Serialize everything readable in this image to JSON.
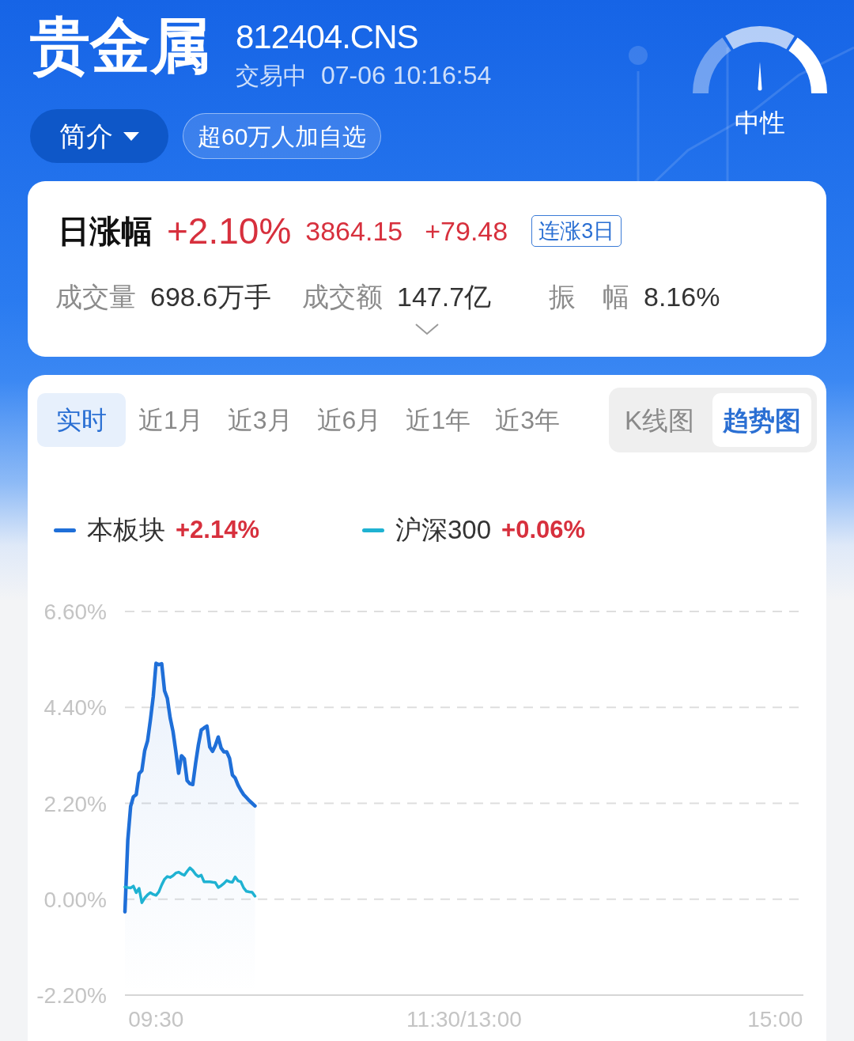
{
  "header": {
    "title": "贵金属",
    "code": "812404.CNS",
    "status": "交易中",
    "datetime": "07-06 10:16:54",
    "buttons": [
      {
        "label": "简介",
        "kind": "dropdown"
      },
      {
        "label": "超60万人加自选",
        "kind": "tag"
      }
    ],
    "sentiment": {
      "label": "中性",
      "level": 0.5
    }
  },
  "quote": {
    "label": "日涨幅",
    "change_pct": "+2.10%",
    "price": "3864.15",
    "change": "+79.48",
    "streak_badge": "连涨3日",
    "stats": [
      {
        "label": "成交量",
        "value": "698.6万手"
      },
      {
        "label": "成交额",
        "value": "147.7亿"
      },
      {
        "label": "振　幅",
        "value": "8.16%"
      }
    ],
    "expanded": false
  },
  "chart_panel": {
    "periods": [
      {
        "label": "实时",
        "selected": true
      },
      {
        "label": "近1月",
        "selected": false
      },
      {
        "label": "近3月",
        "selected": false
      },
      {
        "label": "近6月",
        "selected": false
      },
      {
        "label": "近1年",
        "selected": false
      },
      {
        "label": "近3年",
        "selected": false
      }
    ],
    "views": [
      {
        "label": "K线图",
        "selected": false
      },
      {
        "label": "趋势图",
        "selected": true
      }
    ],
    "legend_values": [
      "+2.14%",
      "+0.06%"
    ],
    "chart_data": {
      "type": "line",
      "grid": true,
      "categories": [
        null,
        null,
        null,
        null,
        null,
        null,
        null,
        null,
        null,
        null,
        null,
        "09:30",
        null,
        null,
        null,
        null,
        null,
        null,
        null,
        null,
        null,
        null,
        null,
        null,
        null,
        null,
        null,
        null,
        null,
        null,
        null,
        null,
        null,
        null,
        null,
        null,
        null,
        null,
        null,
        null,
        null,
        null,
        null,
        null,
        null,
        null,
        null,
        null,
        null,
        null,
        null,
        null,
        null,
        null,
        null,
        null,
        null,
        null,
        null,
        null,
        null,
        null,
        null,
        null,
        null,
        null,
        null,
        null,
        null,
        null,
        null,
        null,
        null,
        null,
        null,
        null,
        null,
        null,
        null,
        null,
        null,
        null,
        null,
        null,
        null,
        null,
        null,
        null,
        null,
        null,
        null,
        null,
        null,
        null,
        null,
        null,
        null,
        null,
        null,
        null,
        null,
        null,
        null,
        null,
        null,
        null,
        null,
        null,
        null,
        null,
        null,
        null,
        null,
        null,
        null,
        null,
        null,
        null,
        null,
        null,
        "11:30/13:00",
        null,
        null,
        null,
        null,
        null,
        null,
        null,
        null,
        null,
        null,
        null,
        null,
        null,
        null,
        null,
        null,
        null,
        null,
        null,
        null,
        null,
        null,
        null,
        null,
        null,
        null,
        null,
        null,
        null,
        null,
        null,
        null,
        null,
        null,
        null,
        null,
        null,
        null,
        null,
        null,
        null,
        null,
        null,
        null,
        null,
        null,
        null,
        null,
        null,
        null,
        null,
        null,
        null,
        null,
        null,
        null,
        null,
        null,
        null,
        null,
        null,
        null,
        null,
        null,
        null,
        null,
        null,
        null,
        null,
        null,
        null,
        null,
        null,
        null,
        null,
        null,
        null,
        null,
        null,
        null,
        null,
        null,
        null,
        null,
        null,
        null,
        null,
        null,
        null,
        null,
        null,
        null,
        null,
        null,
        null,
        null,
        null,
        null,
        null,
        null,
        null,
        null,
        null,
        null,
        null,
        null,
        null,
        null,
        null,
        "15:00",
        null,
        null,
        null,
        null,
        null,
        null,
        null,
        null,
        null,
        null
      ],
      "series": [
        {
          "name": "本板块",
          "color": "#1f6fd8",
          "values": [
            -0.29,
            1.35,
            2.13,
            2.35,
            2.4,
            2.88,
            2.95,
            3.41,
            3.63,
            4.11,
            4.65,
            5.41,
            5.38,
            5.4,
            4.78,
            4.61,
            4.16,
            3.85,
            3.4,
            2.89,
            3.29,
            3.22,
            2.72,
            2.65,
            2.63,
            3.12,
            3.54,
            3.88,
            3.93,
            3.97,
            3.49,
            3.39,
            3.53,
            3.72,
            3.47,
            3.38,
            3.38,
            3.23,
            2.85,
            2.78,
            2.62,
            2.5,
            2.4,
            2.33,
            2.26,
            2.2,
            2.14,
            null,
            null,
            null,
            null,
            null,
            null,
            null,
            null,
            null,
            null,
            null,
            null,
            null,
            null,
            null,
            null,
            null,
            null,
            null,
            null,
            null,
            null,
            null,
            null,
            null,
            null,
            null,
            null,
            null,
            null,
            null,
            null,
            null,
            null,
            null,
            null,
            null,
            null,
            null,
            null,
            null,
            null,
            null,
            null,
            null,
            null,
            null,
            null,
            null,
            null,
            null,
            null,
            null,
            null,
            null,
            null,
            null,
            null,
            null,
            null,
            null,
            null,
            null,
            null,
            null,
            null,
            null,
            null,
            null,
            null,
            null,
            null,
            null,
            null,
            null,
            null,
            null,
            null,
            null,
            null,
            null,
            null,
            null,
            null,
            null,
            null,
            null,
            null,
            null,
            null,
            null,
            null,
            null,
            null,
            null,
            null,
            null,
            null,
            null,
            null,
            null,
            null,
            null,
            null,
            null,
            null,
            null,
            null,
            null,
            null,
            null,
            null,
            null,
            null,
            null,
            null,
            null,
            null,
            null,
            null,
            null,
            null,
            null,
            null,
            null,
            null,
            null,
            null,
            null,
            null,
            null,
            null,
            null,
            null,
            null,
            null,
            null,
            null,
            null,
            null,
            null,
            null,
            null,
            null,
            null,
            null,
            null,
            null,
            null,
            null,
            null,
            null,
            null,
            null,
            null,
            null,
            null,
            null,
            null,
            null,
            null,
            null,
            null,
            null,
            null,
            null,
            null,
            null,
            null,
            null,
            null,
            null,
            null,
            null,
            null,
            null,
            null,
            null,
            null,
            null,
            null,
            null,
            null,
            null,
            null,
            null,
            null,
            null,
            null,
            null,
            null,
            null,
            null,
            null
          ]
        },
        {
          "name": "沪深300",
          "color": "#1fb2d2",
          "values": [
            0.28,
            0.27,
            0.26,
            0.3,
            0.15,
            0.25,
            -0.08,
            0.03,
            0.1,
            0.15,
            0.11,
            0.09,
            0.17,
            0.33,
            0.46,
            0.52,
            0.5,
            0.54,
            0.6,
            0.62,
            0.58,
            0.55,
            0.64,
            0.72,
            0.66,
            0.57,
            0.52,
            0.55,
            0.4,
            0.4,
            0.4,
            0.39,
            0.38,
            0.27,
            0.31,
            0.36,
            0.43,
            0.4,
            0.39,
            0.51,
            0.42,
            0.4,
            0.26,
            0.18,
            0.17,
            0.16,
            0.07,
            null,
            null,
            null,
            null,
            null,
            null,
            null,
            null,
            null,
            null,
            null,
            null,
            null,
            null,
            null,
            null,
            null,
            null,
            null,
            null,
            null,
            null,
            null,
            null,
            null,
            null,
            null,
            null,
            null,
            null,
            null,
            null,
            null,
            null,
            null,
            null,
            null,
            null,
            null,
            null,
            null,
            null,
            null,
            null,
            null,
            null,
            null,
            null,
            null,
            null,
            null,
            null,
            null,
            null,
            null,
            null,
            null,
            null,
            null,
            null,
            null,
            null,
            null,
            null,
            null,
            null,
            null,
            null,
            null,
            null,
            null,
            null,
            null,
            null,
            null,
            null,
            null,
            null,
            null,
            null,
            null,
            null,
            null,
            null,
            null,
            null,
            null,
            null,
            null,
            null,
            null,
            null,
            null,
            null,
            null,
            null,
            null,
            null,
            null,
            null,
            null,
            null,
            null,
            null,
            null,
            null,
            null,
            null,
            null,
            null,
            null,
            null,
            null,
            null,
            null,
            null,
            null,
            null,
            null,
            null,
            null,
            null,
            null,
            null,
            null,
            null,
            null,
            null,
            null,
            null,
            null,
            null,
            null,
            null,
            null,
            null,
            null,
            null,
            null,
            null,
            null,
            null,
            null,
            null,
            null,
            null,
            null,
            null,
            null,
            null,
            null,
            null,
            null,
            null,
            null,
            null,
            null,
            null,
            null,
            null,
            null,
            null,
            null,
            null,
            null,
            null,
            null,
            null,
            null,
            null,
            null,
            null,
            null,
            null,
            null,
            null,
            null,
            null,
            null,
            null,
            null,
            null,
            null,
            null,
            null,
            null,
            null,
            null,
            null,
            null,
            null,
            null,
            null,
            null
          ]
        }
      ],
      "ylim": [
        -2.2,
        6.6
      ],
      "yticks": [
        {
          "value": 6.6,
          "label": "6.60%"
        },
        {
          "value": 4.4,
          "label": "4.40%"
        },
        {
          "value": 2.2,
          "label": "2.20%"
        },
        {
          "value": 0,
          "label": "0.00%"
        },
        {
          "value": -2.2,
          "label": "-2.20%"
        }
      ]
    }
  }
}
